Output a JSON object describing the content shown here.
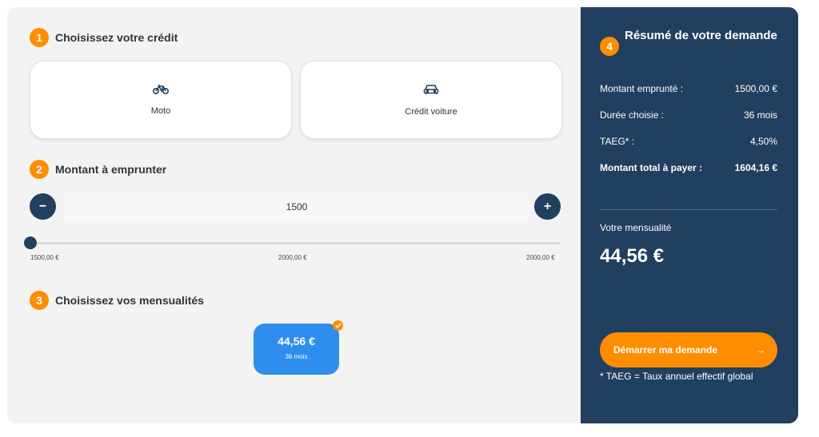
{
  "steps": {
    "s1": {
      "num": "1",
      "title": "Choisissez votre crédit"
    },
    "s2": {
      "num": "2",
      "title": "Montant à emprunter"
    },
    "s3": {
      "num": "3",
      "title": "Choisissez vos mensualités"
    },
    "s4": {
      "num": "4",
      "title": "Résumé de votre demande"
    }
  },
  "credit_choices": [
    {
      "icon": "bicycle-icon",
      "label": "Moto"
    },
    {
      "icon": "car-icon",
      "label": "Crédit voiture"
    }
  ],
  "amount": {
    "minus_label": "−",
    "plus_label": "+",
    "value": "1500",
    "slider_fraction": 0,
    "ticks": [
      "1500,00 €",
      "2000,00 €",
      "2000,00 €"
    ]
  },
  "monthly_option": {
    "value": "44,56 €",
    "duration": "36 mois",
    "selected": true
  },
  "summary": {
    "rows": [
      {
        "label": "Montant emprunté :",
        "value": "1500,00 €"
      },
      {
        "label": "Durée choisie :",
        "value": "36 mois"
      },
      {
        "label": "TAEG* :",
        "value": "4,50%"
      },
      {
        "label": "Montant total à payer :",
        "value": "1604,16 €"
      }
    ],
    "monthly_label": "Votre mensualité",
    "monthly_value": "44,56 €",
    "cta_label": "Démarrer ma demande",
    "cta_arrow": "→",
    "note": "* TAEG = Taux annuel effectif global"
  },
  "colors": {
    "accent": "#ff8d00",
    "navy": "#213f5e",
    "blue": "#2e8ef0",
    "background": "#f3f3f3"
  }
}
